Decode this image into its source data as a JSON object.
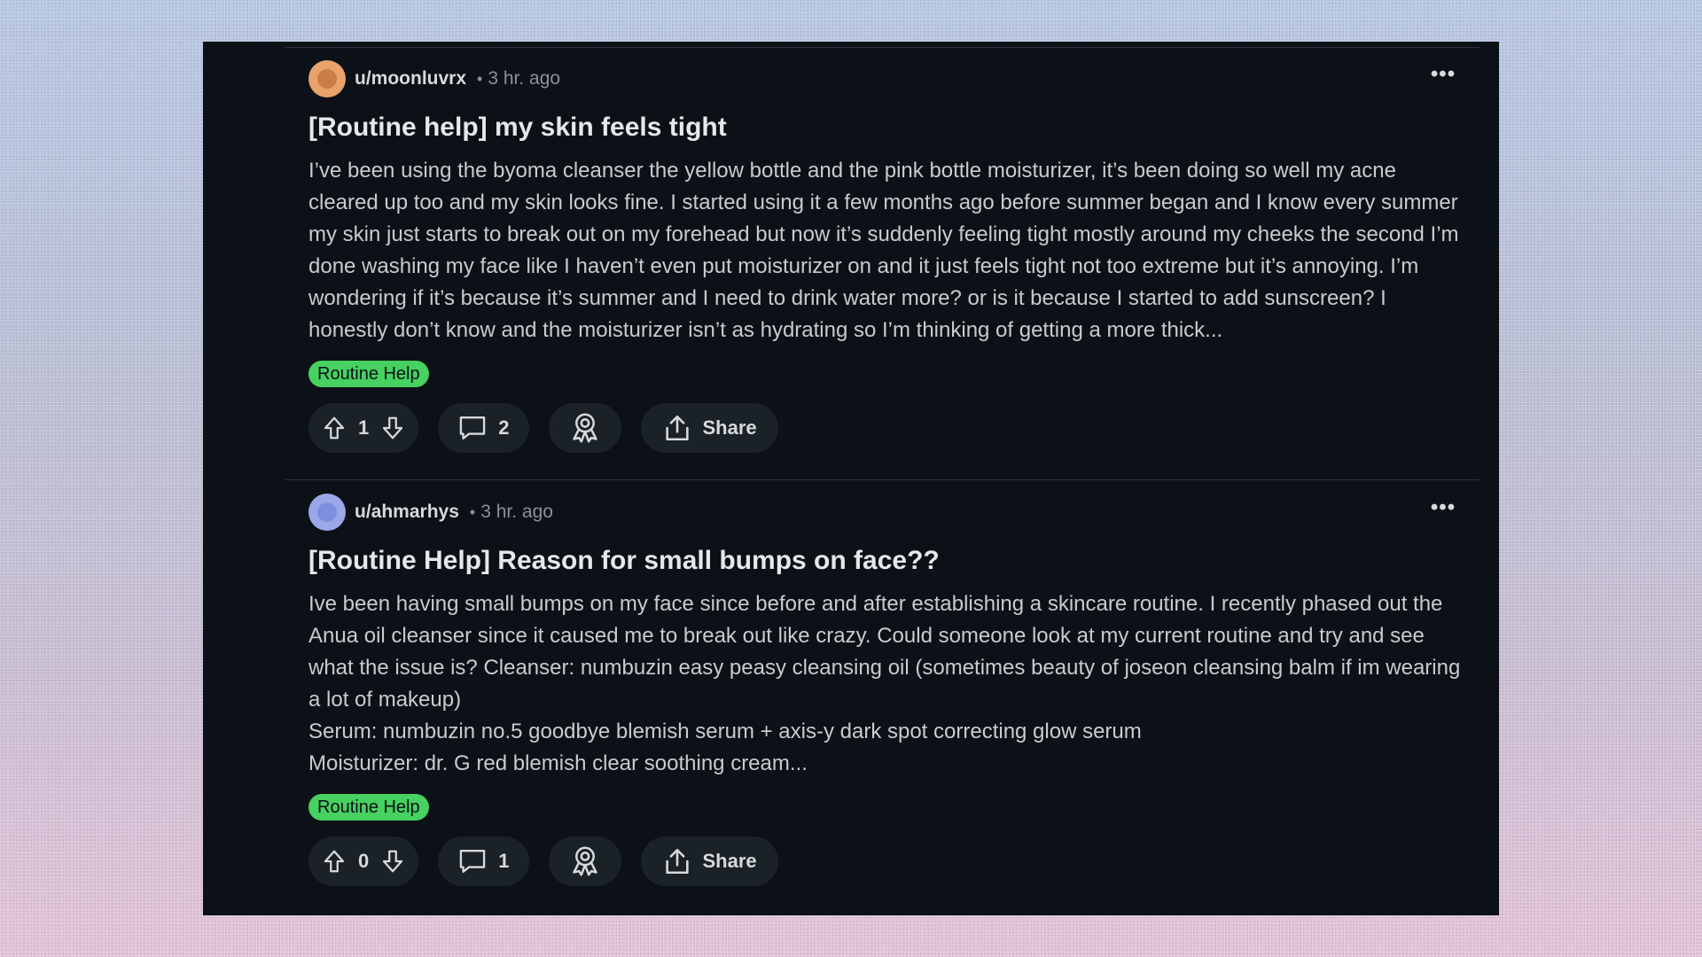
{
  "posts": [
    {
      "username": "u/moonluvrx",
      "time": "3 hr. ago",
      "title": "[Routine help] my skin feels tight",
      "body": [
        "I’ve been using the byoma cleanser the yellow bottle and the pink bottle moisturizer, it’s been doing so well my acne cleared up too and my skin looks fine. I started using it a few months ago before summer began and I know every summer my skin just starts to break out on my forehead but now it’s suddenly feeling tight mostly around my cheeks the second I’m done washing my face like I haven’t even put moisturizer on and it just feels tight not too extreme but it’s annoying. I’m wondering if it’s because it’s summer and I need to drink water more? or is it because I started to add sunscreen? I honestly don’t know and the moisturizer isn’t as hydrating so I’m thinking of getting a more thick..."
      ],
      "flair": "Routine Help",
      "votes": "1",
      "comments": "2",
      "share_label": "Share"
    },
    {
      "username": "u/ahmarhys",
      "time": "3 hr. ago",
      "title": "[Routine Help] Reason for small bumps on face??",
      "body": [
        "Ive been having small bumps on my face since before and after establishing a skincare routine. I recently phased out the Anua oil cleanser since it caused me to break out like crazy. Could someone look at my current routine and try and see what the issue is? Cleanser: numbuzin easy peasy cleansing oil (sometimes beauty of joseon cleansing balm if im wearing a lot of makeup)",
        "Serum: numbuzin no.5 goodbye blemish serum + axis-y dark spot correcting glow serum",
        "Moisturizer: dr. G red blemish clear soothing cream..."
      ],
      "flair": "Routine Help",
      "votes": "0",
      "comments": "1",
      "share_label": "Share"
    }
  ],
  "meta_separator": "•",
  "more_glyph": "•••",
  "colors": {
    "panel_bg": "#0b1116",
    "flair_bg": "#46d160",
    "button_bg": "#1a2228",
    "text_primary": "#d7dadc",
    "text_muted": "#8b9196"
  },
  "icons": [
    "upvote-icon",
    "downvote-icon",
    "comment-icon",
    "award-icon",
    "share-icon",
    "more-options-icon"
  ]
}
